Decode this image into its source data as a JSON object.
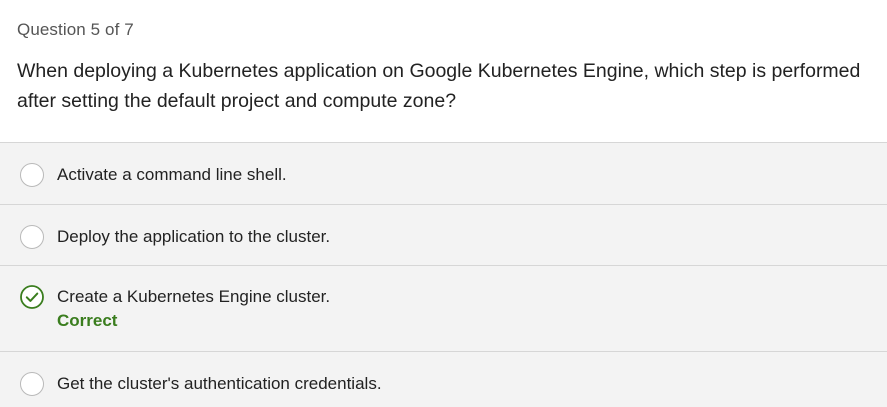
{
  "quiz": {
    "counter": "Question 5 of 7",
    "question": "When deploying a Kubernetes application on Google Kubernetes Engine, which step is performed after setting the default project and compute zone?",
    "options": [
      {
        "label": "Activate a command line shell.",
        "state": "unselected"
      },
      {
        "label": "Deploy the application to the cluster.",
        "state": "unselected"
      },
      {
        "label": "Create a Kubernetes Engine cluster.",
        "state": "correct",
        "feedback": "Correct"
      },
      {
        "label": "Get the cluster's authentication credentials.",
        "state": "unselected"
      }
    ]
  },
  "colors": {
    "correct": "#3a7d1e",
    "option_background": "#f3f3f3",
    "divider": "#d6d6d6"
  },
  "icons": {
    "radio": "radio-button-icon",
    "correct": "check-circle-icon"
  }
}
